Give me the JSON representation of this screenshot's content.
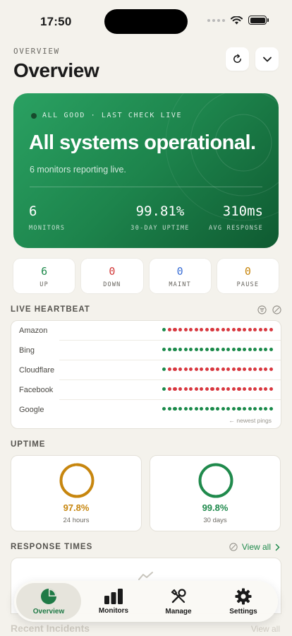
{
  "status_bar": {
    "time": "17:50"
  },
  "header": {
    "eyebrow": "OVERVIEW",
    "title": "Overview"
  },
  "hero": {
    "status_line": "ALL GOOD · LAST CHECK LIVE",
    "title": "All systems operational.",
    "subtitle": "6 monitors reporting live.",
    "stats": [
      {
        "value": "6",
        "label": "MONITORS"
      },
      {
        "value": "99.81%",
        "label": "30-DAY UPTIME"
      },
      {
        "value": "310ms",
        "label": "AVG RESPONSE"
      }
    ]
  },
  "counts": [
    {
      "value": "6",
      "label": "UP",
      "color": "#1f8a4c"
    },
    {
      "value": "0",
      "label": "DOWN",
      "color": "#d23a3a"
    },
    {
      "value": "0",
      "label": "MAINT",
      "color": "#3b6fd6"
    },
    {
      "value": "0",
      "label": "PAUSE",
      "color": "#c7860e"
    }
  ],
  "heartbeat": {
    "title": "LIVE HEARTBEAT",
    "footer": "← newest pings",
    "colors": {
      "up": "#1a8a4a",
      "down": "#d8373f"
    },
    "monitors": [
      {
        "name": "Amazon",
        "pings": "udddddddddddddddddddd"
      },
      {
        "name": "Bing",
        "pings": "uuuuuuuuuuuuuuuuuuuuu"
      },
      {
        "name": "Cloudflare",
        "pings": "udddddddddddddddddddd"
      },
      {
        "name": "Facebook",
        "pings": "udddddddddddddddddddd"
      },
      {
        "name": "Google",
        "pings": "uuuuuuuuuuuuuuuuuuuuu"
      }
    ]
  },
  "uptime": {
    "title": "UPTIME",
    "cards": [
      {
        "percent": "97.8%",
        "period": "24 hours",
        "color": "#c7860e",
        "value": 0.978
      },
      {
        "percent": "99.8%",
        "period": "30 days",
        "color": "#1f8a4c",
        "value": 0.998
      }
    ]
  },
  "response": {
    "title": "RESPONSE TIMES",
    "view_all": "View all"
  },
  "recent": {
    "title": "Recent Incidents",
    "view_all": "View all"
  },
  "nav": [
    {
      "label": "Overview",
      "icon": "pie-chart-icon",
      "active": true
    },
    {
      "label": "Monitors",
      "icon": "bar-chart-icon",
      "active": false
    },
    {
      "label": "Manage",
      "icon": "wrench-screwdriver-icon",
      "active": false
    },
    {
      "label": "Settings",
      "icon": "gear-icon",
      "active": false
    }
  ]
}
